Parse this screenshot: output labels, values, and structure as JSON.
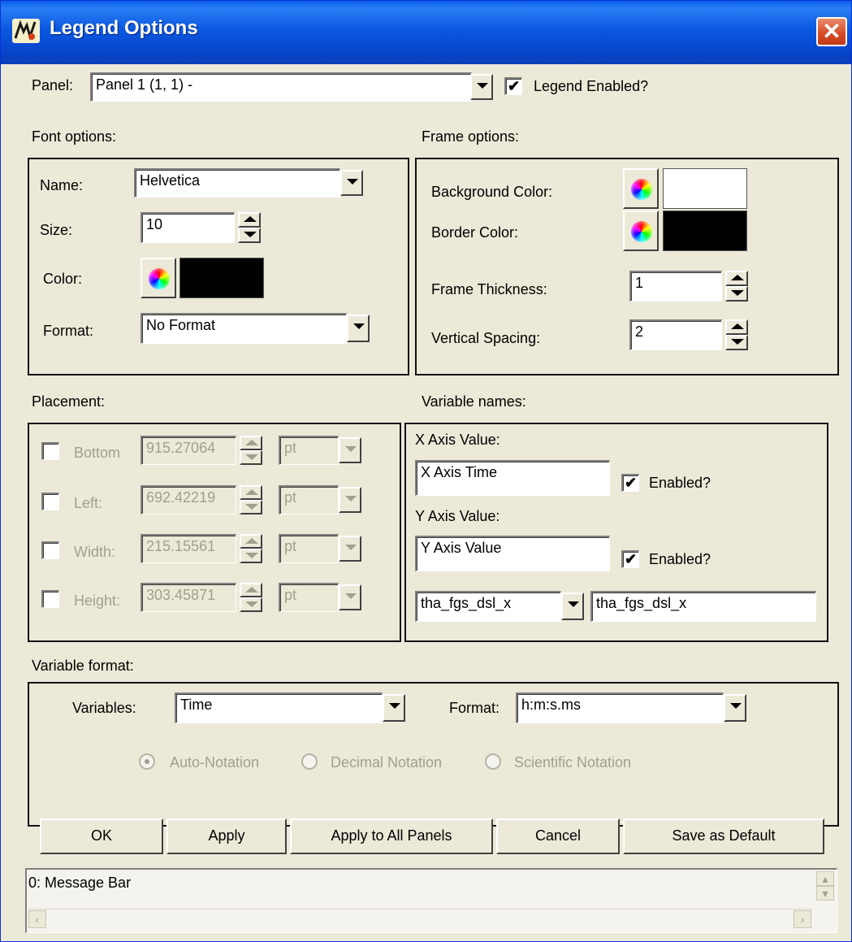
{
  "window": {
    "title": "Legend Options",
    "close_glyph": "✕",
    "app_icon": "idl-logo-icon"
  },
  "panel": {
    "label": "Panel:",
    "value": "Panel 1 (1, 1) -",
    "legend_enabled_label": "Legend Enabled?",
    "legend_enabled": true
  },
  "font_options": {
    "heading": "Font options:",
    "name_label": "Name:",
    "name_value": "Helvetica",
    "size_label": "Size:",
    "size_value": "10",
    "color_label": "Color:",
    "color_value": "#000000",
    "format_label": "Format:",
    "format_value": "No Format"
  },
  "frame_options": {
    "heading": "Frame options:",
    "bg_label": "Background Color:",
    "bg_color": "#ffffff",
    "border_label": "Border Color:",
    "border_color": "#000000",
    "thickness_label": "Frame Thickness:",
    "thickness_value": "1",
    "spacing_label": "Vertical Spacing:",
    "spacing_value": "2"
  },
  "placement": {
    "heading": "Placement:",
    "rows": [
      {
        "label": "Bottom",
        "value": "915.27064",
        "unit": "pt"
      },
      {
        "label": "Left:",
        "value": "692.42219",
        "unit": "pt"
      },
      {
        "label": "Width:",
        "value": "215.15561",
        "unit": "pt"
      },
      {
        "label": "Height:",
        "value": "303.45871",
        "unit": "pt"
      }
    ]
  },
  "variable_names": {
    "heading": "Variable names:",
    "x_label": "X Axis Value:",
    "x_value": "X Axis Time",
    "x_enabled_label": "Enabled?",
    "y_label": "Y Axis Value:",
    "y_value": "Y Axis Value",
    "y_enabled_label": "Enabled?",
    "var_select": "tha_fgs_dsl_x",
    "var_value": "tha_fgs_dsl_x"
  },
  "variable_format": {
    "heading": "Variable format:",
    "variables_label": "Variables:",
    "variables_value": "Time",
    "format_label": "Format:",
    "format_value": "h:m:s.ms",
    "notations": [
      "Auto-Notation",
      "Decimal Notation",
      "Scientific Notation"
    ],
    "selected_notation": "Auto-Notation"
  },
  "buttons": {
    "ok": "OK",
    "apply": "Apply",
    "apply_all": "Apply to All Panels",
    "cancel": "Cancel",
    "save_default": "Save as Default"
  },
  "message_bar": {
    "text": "0: Message Bar"
  },
  "colors": {
    "titlebar": "#0a5fe8",
    "dialog_bg": "#ece9d8",
    "disabled_text": "#a19f8d"
  }
}
